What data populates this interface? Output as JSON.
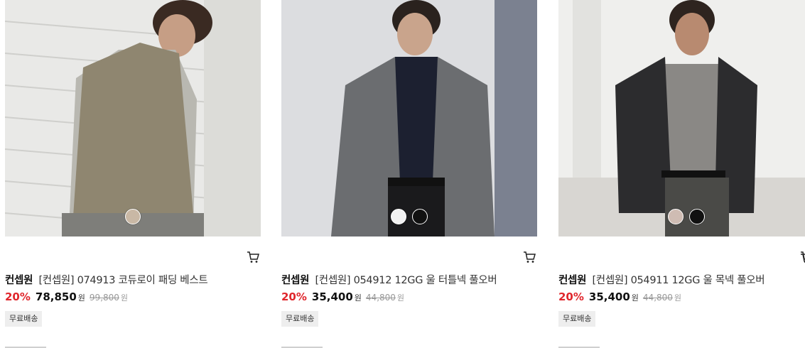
{
  "products": [
    {
      "brand": "컨셉원",
      "name": "[컨셉원] 074913 코듀로이 패딩 베스트",
      "discount": "20%",
      "price": "78,850",
      "currency": "원",
      "original_price": "99,800",
      "shipping_badge": "무료배송",
      "swatches": [
        "#c9b8a5"
      ]
    },
    {
      "brand": "컨셉원",
      "name": "[컨셉원] 054912 12GG 울 터틀넥 풀오버",
      "discount": "20%",
      "price": "35,400",
      "currency": "원",
      "original_price": "44,800",
      "shipping_badge": "무료배송",
      "swatches": [
        "#f2f2f2",
        "#111111"
      ]
    },
    {
      "brand": "컨셉원",
      "name": "[컨셉원] 054911 12GG 울 목넥 풀오버",
      "discount": "20%",
      "price": "35,400",
      "currency": "원",
      "original_price": "44,800",
      "shipping_badge": "무료배송",
      "swatches": [
        "#cfbcb3",
        "#111111"
      ]
    }
  ],
  "colors": {
    "discount": "#e0262c",
    "badge_bg": "#eeeeee"
  }
}
